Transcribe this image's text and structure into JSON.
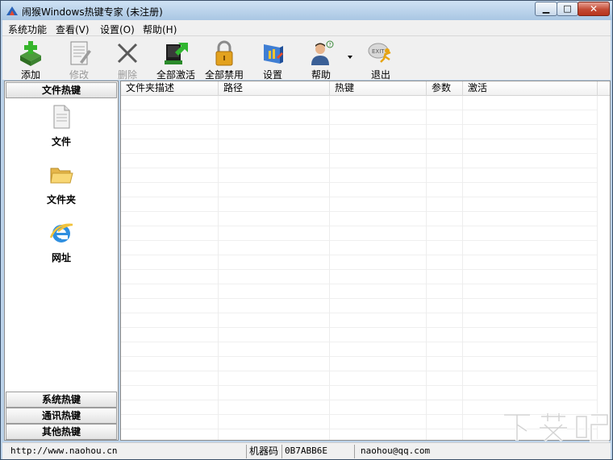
{
  "window": {
    "title": "闹猴Windows热键专家 (未注册)",
    "controls": {
      "minimize": "▁",
      "maximize": "□",
      "close": "✕"
    }
  },
  "menu": [
    "系统功能",
    "查看(V)",
    "设置(O)",
    "帮助(H)"
  ],
  "toolbar": {
    "add": {
      "label": "添加",
      "icon": "add-icon"
    },
    "edit": {
      "label": "修改",
      "icon": "edit-document-icon",
      "enabled": false
    },
    "delete": {
      "label": "删除",
      "icon": "delete-x-icon",
      "enabled": false
    },
    "activate_all": {
      "label": "全部激活",
      "icon": "monitor-activate-icon"
    },
    "disable_all": {
      "label": "全部禁用",
      "icon": "padlock-icon"
    },
    "settings": {
      "label": "设置",
      "icon": "settings-icon"
    },
    "help": {
      "label": "帮助",
      "icon": "help-person-icon"
    },
    "exit": {
      "label": "退出",
      "icon": "exit-running-icon"
    }
  },
  "left_panel": {
    "active_group": "文件热键",
    "items": [
      {
        "label": "文件",
        "icon": "file-icon"
      },
      {
        "label": "文件夹",
        "icon": "folder-icon"
      },
      {
        "label": "网址",
        "icon": "internet-explorer-icon"
      }
    ],
    "other_groups": [
      "系统热键",
      "通讯热键",
      "其他热键"
    ]
  },
  "list": {
    "columns": [
      "文件夹描述",
      "路径",
      "热键",
      "参数",
      "激活"
    ],
    "rows": []
  },
  "status": {
    "website": "http://www.naohou.cn",
    "machine_code_label": "机器码",
    "machine_code": "0B7ABB6E",
    "email": "naohou@qq.com"
  },
  "watermark": "下载吧",
  "colors": {
    "accent": "#1a4f9c",
    "close_button": "#c24a34"
  }
}
